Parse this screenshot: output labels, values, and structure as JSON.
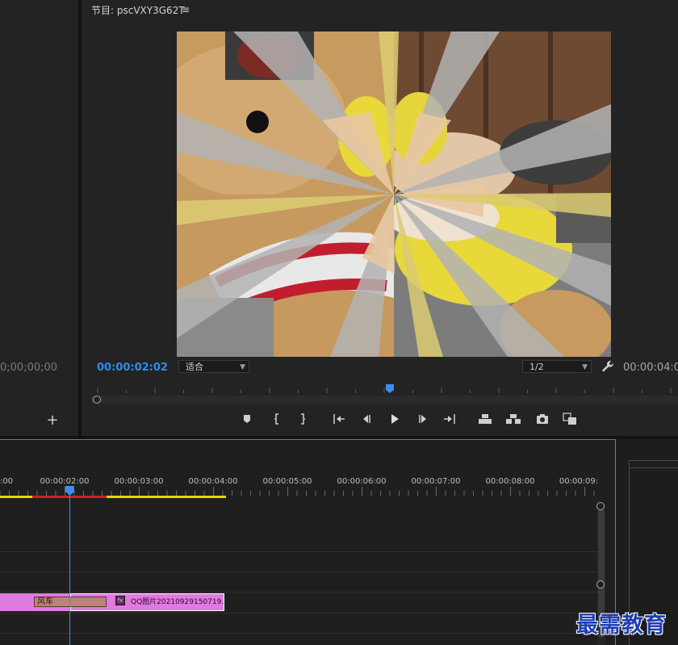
{
  "source_monitor": {
    "timecode": "0;00;00;00"
  },
  "program_monitor": {
    "title": "节目: pscVXY3G62T",
    "menu_glyph": "≡",
    "current_timecode": "00:00:02:02",
    "fit_label": "适合",
    "resolution_label": "1/2",
    "duration_timecode": "00:00:04:0",
    "playhead_fraction": 0.5
  },
  "transport_icons": [
    "add-marker-icon",
    "mark-in-icon",
    "mark-out-icon",
    "go-to-in-icon",
    "step-back-icon",
    "play-icon",
    "step-forward-icon",
    "go-to-out-icon",
    "lift-icon",
    "extract-icon",
    "export-frame-icon",
    "compare-view-icon"
  ],
  "timeline": {
    "ruler_labels": [
      ":00",
      "00:00:02:00",
      "00:00:03:00",
      "00:00:04:00",
      "00:00:05:00",
      "00:00:06:00",
      "00:00:07:00",
      "00:00:08:00",
      "00:00:09:"
    ],
    "transition_label": "风车",
    "clip_name": "QQ图片20210929150719.",
    "clip_badge": "fx",
    "colors": {
      "clip": "#e07ae0",
      "transition": "#b98575",
      "playhead": "#3d8cf0",
      "work_area_yellow": "#e6d600",
      "work_area_red": "#d11f1f"
    }
  },
  "watermark": {
    "text": "最需教育"
  },
  "colors": {
    "timecode_accent": "#2d8ceb",
    "panel_bg": "#232323"
  }
}
